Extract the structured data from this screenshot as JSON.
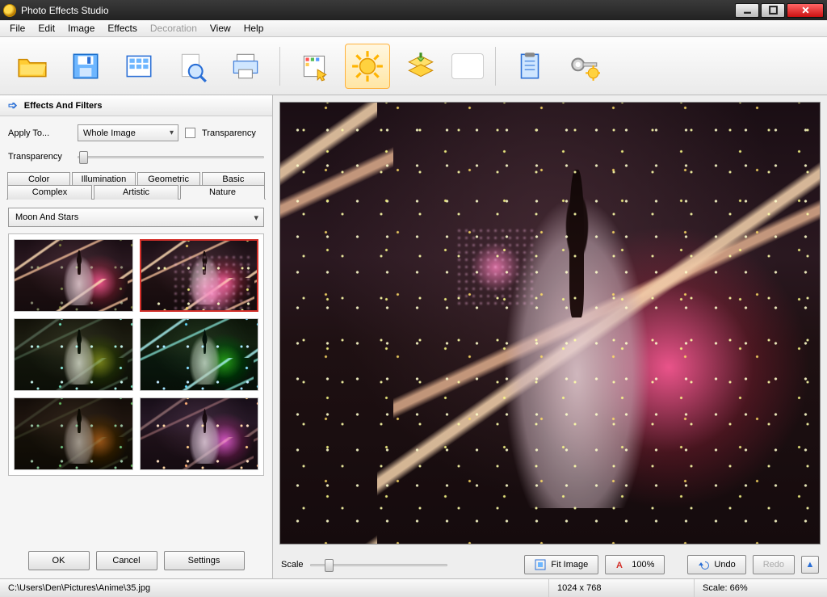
{
  "titlebar": {
    "title": "Photo Effects Studio"
  },
  "menu": {
    "file": "File",
    "edit": "Edit",
    "image": "Image",
    "effects": "Effects",
    "decoration": "Decoration",
    "view": "View",
    "help": "Help"
  },
  "panel": {
    "title": "Effects And Filters",
    "applyto_lbl": "Apply To...",
    "applyto_val": "Whole Image",
    "transp_cb": "Transparency",
    "transp_lbl": "Transparency",
    "tabs": {
      "color": "Color",
      "illum": "Illumination",
      "geom": "Geometric",
      "basic": "Basic",
      "complex": "Complex",
      "artistic": "Artistic",
      "nature": "Nature"
    },
    "preset": "Moon And Stars",
    "ok": "OK",
    "cancel": "Cancel",
    "settings": "Settings"
  },
  "bottom": {
    "scale": "Scale",
    "fit": "Fit Image",
    "hundred": "100%",
    "undo": "Undo",
    "redo": "Redo"
  },
  "status": {
    "path": "C:\\Users\\Den\\Pictures\\Anime\\35.jpg",
    "dim": "1024 x 768",
    "scale": "Scale: 66%"
  }
}
